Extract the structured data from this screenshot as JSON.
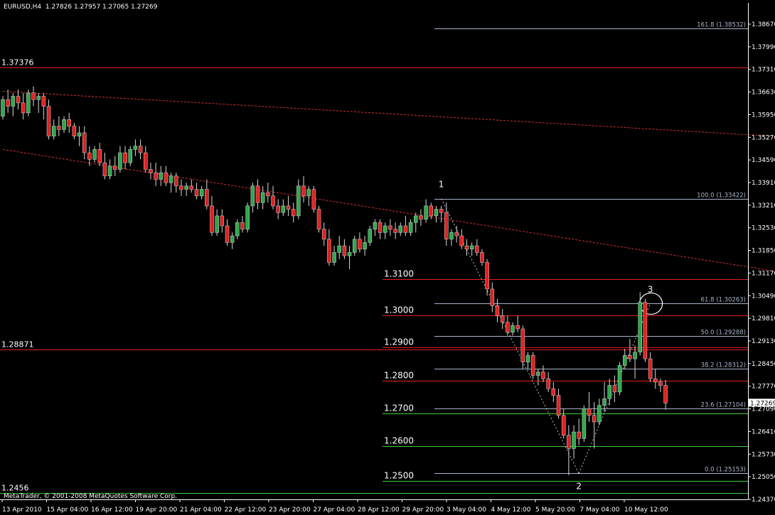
{
  "header": {
    "symbol": "EURUSD,H4",
    "open": "1.27826",
    "high": "1.27957",
    "low": "1.27065",
    "close": "1.27269"
  },
  "footer": {
    "copyright": "MetaTrader, © 2001-2008 MetaQuotes Software Corp."
  },
  "colors": {
    "background": "#000000",
    "axis": "#ffffff",
    "bull": "#2ea84a",
    "bear": "#e02020",
    "resistance": "#e02020",
    "support": "#3cc83c",
    "fib": "#a8b4c8",
    "trend": "#d03030",
    "wave": "#ffffff"
  },
  "chart_data": {
    "type": "candlestick",
    "symbol": "EURUSD",
    "timeframe": "H4",
    "ylim": [
      1.2437,
      1.3867
    ],
    "y_ticks": [
      "1.38670",
      "1.37990",
      "1.37310",
      "1.36630",
      "1.35950",
      "1.35270",
      "1.34590",
      "1.33910",
      "1.33210",
      "1.32530",
      "1.31850",
      "1.31170",
      "1.30490",
      "1.29810",
      "1.29130",
      "1.28450",
      "1.27770",
      "1.27090",
      "1.26410",
      "1.25730",
      "1.25050",
      "1.24370"
    ],
    "current_price": "1.27269",
    "x_ticks": [
      "13 Apr 2010",
      "15 Apr 04:00",
      "16 Apr 12:00",
      "19 Apr 20:00",
      "21 Apr 04:00",
      "22 Apr 12:00",
      "23 Apr 20:00",
      "27 Apr 04:00",
      "28 Apr 12:00",
      "29 Apr 20:00",
      "3 May 04:00",
      "4 May 12:00",
      "5 May 20:00",
      "7 May 04:00",
      "10 May 12:00"
    ],
    "candles": [
      [
        1.359,
        1.365,
        1.358,
        1.364
      ],
      [
        1.364,
        1.367,
        1.36,
        1.362
      ],
      [
        1.362,
        1.366,
        1.359,
        1.365
      ],
      [
        1.365,
        1.367,
        1.361,
        1.363
      ],
      [
        1.363,
        1.366,
        1.358,
        1.36
      ],
      [
        1.36,
        1.367,
        1.359,
        1.366
      ],
      [
        1.366,
        1.368,
        1.362,
        1.364
      ],
      [
        1.364,
        1.366,
        1.36,
        1.365
      ],
      [
        1.365,
        1.366,
        1.358,
        1.362
      ],
      [
        1.362,
        1.364,
        1.352,
        1.353
      ],
      [
        1.353,
        1.358,
        1.352,
        1.356
      ],
      [
        1.356,
        1.359,
        1.353,
        1.355
      ],
      [
        1.355,
        1.359,
        1.354,
        1.358
      ],
      [
        1.358,
        1.36,
        1.354,
        1.356
      ],
      [
        1.356,
        1.357,
        1.352,
        1.353
      ],
      [
        1.353,
        1.356,
        1.35,
        1.354
      ],
      [
        1.354,
        1.356,
        1.346,
        1.348
      ],
      [
        1.348,
        1.35,
        1.344,
        1.346
      ],
      [
        1.346,
        1.35,
        1.345,
        1.349
      ],
      [
        1.349,
        1.351,
        1.344,
        1.345
      ],
      [
        1.345,
        1.348,
        1.34,
        1.341
      ],
      [
        1.341,
        1.346,
        1.34,
        1.344
      ],
      [
        1.344,
        1.347,
        1.341,
        1.343
      ],
      [
        1.343,
        1.35,
        1.342,
        1.348
      ],
      [
        1.348,
        1.35,
        1.343,
        1.345
      ],
      [
        1.345,
        1.35,
        1.344,
        1.349
      ],
      [
        1.349,
        1.352,
        1.347,
        1.35
      ],
      [
        1.35,
        1.352,
        1.346,
        1.348
      ],
      [
        1.348,
        1.35,
        1.342,
        1.343
      ],
      [
        1.343,
        1.345,
        1.34,
        1.342
      ],
      [
        1.342,
        1.345,
        1.338,
        1.34
      ],
      [
        1.34,
        1.344,
        1.338,
        1.342
      ],
      [
        1.342,
        1.344,
        1.338,
        1.339
      ],
      [
        1.339,
        1.342,
        1.336,
        1.341
      ],
      [
        1.341,
        1.342,
        1.336,
        1.338
      ],
      [
        1.338,
        1.34,
        1.335,
        1.337
      ],
      [
        1.337,
        1.339,
        1.335,
        1.338
      ],
      [
        1.338,
        1.34,
        1.336,
        1.337
      ],
      [
        1.337,
        1.339,
        1.334,
        1.335
      ],
      [
        1.335,
        1.338,
        1.334,
        1.337
      ],
      [
        1.337,
        1.34,
        1.331,
        1.332
      ],
      [
        1.332,
        1.335,
        1.323,
        1.324
      ],
      [
        1.324,
        1.331,
        1.323,
        1.329
      ],
      [
        1.329,
        1.331,
        1.324,
        1.326
      ],
      [
        1.326,
        1.328,
        1.32,
        1.321
      ],
      [
        1.321,
        1.324,
        1.319,
        1.323
      ],
      [
        1.323,
        1.328,
        1.322,
        1.327
      ],
      [
        1.327,
        1.329,
        1.324,
        1.325
      ],
      [
        1.325,
        1.333,
        1.324,
        1.332
      ],
      [
        1.332,
        1.339,
        1.33,
        1.338
      ],
      [
        1.338,
        1.34,
        1.331,
        1.333
      ],
      [
        1.333,
        1.338,
        1.331,
        1.336
      ],
      [
        1.336,
        1.339,
        1.333,
        1.335
      ],
      [
        1.335,
        1.338,
        1.331,
        1.332
      ],
      [
        1.332,
        1.334,
        1.328,
        1.33
      ],
      [
        1.33,
        1.334,
        1.329,
        1.332
      ],
      [
        1.332,
        1.335,
        1.329,
        1.331
      ],
      [
        1.331,
        1.333,
        1.327,
        1.329
      ],
      [
        1.329,
        1.34,
        1.328,
        1.338
      ],
      [
        1.338,
        1.341,
        1.333,
        1.335
      ],
      [
        1.335,
        1.338,
        1.332,
        1.337
      ],
      [
        1.337,
        1.338,
        1.33,
        1.331
      ],
      [
        1.331,
        1.332,
        1.324,
        1.325
      ],
      [
        1.325,
        1.327,
        1.32,
        1.322
      ],
      [
        1.322,
        1.325,
        1.314,
        1.315
      ],
      [
        1.315,
        1.32,
        1.314,
        1.318
      ],
      [
        1.318,
        1.323,
        1.316,
        1.32
      ],
      [
        1.32,
        1.322,
        1.316,
        1.317
      ],
      [
        1.317,
        1.32,
        1.313,
        1.318
      ],
      [
        1.318,
        1.323,
        1.317,
        1.322
      ],
      [
        1.322,
        1.324,
        1.318,
        1.319
      ],
      [
        1.319,
        1.323,
        1.317,
        1.321
      ],
      [
        1.321,
        1.326,
        1.32,
        1.325
      ],
      [
        1.325,
        1.328,
        1.323,
        1.327
      ],
      [
        1.327,
        1.328,
        1.322,
        1.324
      ],
      [
        1.324,
        1.327,
        1.322,
        1.326
      ],
      [
        1.326,
        1.328,
        1.323,
        1.325
      ],
      [
        1.325,
        1.327,
        1.322,
        1.324
      ],
      [
        1.324,
        1.327,
        1.323,
        1.326
      ],
      [
        1.326,
        1.329,
        1.323,
        1.324
      ],
      [
        1.324,
        1.328,
        1.323,
        1.327
      ],
      [
        1.327,
        1.33,
        1.324,
        1.329
      ],
      [
        1.329,
        1.331,
        1.326,
        1.328
      ],
      [
        1.328,
        1.334,
        1.327,
        1.332
      ],
      [
        1.332,
        1.333,
        1.328,
        1.329
      ],
      [
        1.329,
        1.332,
        1.327,
        1.331
      ],
      [
        1.331,
        1.332,
        1.327,
        1.33
      ],
      [
        1.33,
        1.333,
        1.32,
        1.322
      ],
      [
        1.322,
        1.325,
        1.32,
        1.324
      ],
      [
        1.324,
        1.326,
        1.321,
        1.323
      ],
      [
        1.323,
        1.325,
        1.319,
        1.32
      ],
      [
        1.32,
        1.322,
        1.317,
        1.319
      ],
      [
        1.319,
        1.321,
        1.317,
        1.32
      ],
      [
        1.32,
        1.322,
        1.317,
        1.318
      ],
      [
        1.318,
        1.319,
        1.314,
        1.315
      ],
      [
        1.315,
        1.316,
        1.305,
        1.307
      ],
      [
        1.307,
        1.309,
        1.3,
        1.302
      ],
      [
        1.302,
        1.304,
        1.297,
        1.299
      ],
      [
        1.299,
        1.301,
        1.295,
        1.297
      ],
      [
        1.297,
        1.299,
        1.293,
        1.294
      ],
      [
        1.294,
        1.297,
        1.293,
        1.296
      ],
      [
        1.296,
        1.299,
        1.294,
        1.295
      ],
      [
        1.295,
        1.296,
        1.283,
        1.285
      ],
      [
        1.285,
        1.288,
        1.283,
        1.287
      ],
      [
        1.287,
        1.288,
        1.28,
        1.281
      ],
      [
        1.281,
        1.283,
        1.278,
        1.282
      ],
      [
        1.282,
        1.284,
        1.279,
        1.28
      ],
      [
        1.28,
        1.282,
        1.276,
        1.277
      ],
      [
        1.277,
        1.279,
        1.273,
        1.275
      ],
      [
        1.275,
        1.277,
        1.268,
        1.269
      ],
      [
        1.269,
        1.271,
        1.262,
        1.263
      ],
      [
        1.263,
        1.266,
        1.251,
        1.259
      ],
      [
        1.259,
        1.266,
        1.256,
        1.264
      ],
      [
        1.264,
        1.268,
        1.26,
        1.262
      ],
      [
        1.262,
        1.272,
        1.261,
        1.271
      ],
      [
        1.271,
        1.276,
        1.267,
        1.269
      ],
      [
        1.269,
        1.273,
        1.259,
        1.267
      ],
      [
        1.267,
        1.274,
        1.266,
        1.272
      ],
      [
        1.272,
        1.279,
        1.27,
        1.274
      ],
      [
        1.274,
        1.28,
        1.272,
        1.278
      ],
      [
        1.278,
        1.281,
        1.273,
        1.276
      ],
      [
        1.276,
        1.285,
        1.275,
        1.284
      ],
      [
        1.284,
        1.289,
        1.283,
        1.287
      ],
      [
        1.287,
        1.292,
        1.285,
        1.286
      ],
      [
        1.286,
        1.29,
        1.28,
        1.288
      ],
      [
        1.288,
        1.306,
        1.287,
        1.303
      ],
      [
        1.303,
        1.304,
        1.285,
        1.286
      ],
      [
        1.286,
        1.288,
        1.279,
        1.28
      ],
      [
        1.28,
        1.283,
        1.277,
        1.279
      ],
      [
        1.279,
        1.28,
        1.276,
        1.278
      ],
      [
        1.278,
        1.2796,
        1.2707,
        1.2727
      ]
    ],
    "horizontal_levels": [
      {
        "label": "1.37376",
        "value": 1.37376,
        "color": "resistance",
        "extent": "full"
      },
      {
        "label": "1.28871",
        "value": 1.28871,
        "color": "resistance",
        "extent": "full"
      },
      {
        "label": "1.2456",
        "value": 1.2456,
        "color": "support",
        "extent": "full"
      },
      {
        "label": "1.3100",
        "value": 1.31,
        "color": "resistance",
        "extent": "right"
      },
      {
        "label": "1.3000",
        "value": 1.299,
        "color": "resistance",
        "extent": "right"
      },
      {
        "label": "1.2900",
        "value": 1.2895,
        "color": "resistance",
        "extent": "right"
      },
      {
        "label": "1.2800",
        "value": 1.2795,
        "color": "resistance",
        "extent": "right"
      },
      {
        "label": "1.2700",
        "value": 1.2695,
        "color": "support",
        "extent": "right"
      },
      {
        "label": "1.2600",
        "value": 1.2597,
        "color": "support",
        "extent": "right"
      },
      {
        "label": "1.2500",
        "value": 1.2492,
        "color": "support",
        "extent": "right"
      }
    ],
    "fib_levels": [
      {
        "label": "161.8 (1.38532)",
        "value": 1.38532
      },
      {
        "label": "100.0 (1.33422)",
        "value": 1.33422
      },
      {
        "label": "61.8 (1.30263)",
        "value": 1.30263
      },
      {
        "label": "50.0 (1.29288)",
        "value": 1.29288
      },
      {
        "label": "38.2 (1.28312)",
        "value": 1.28312
      },
      {
        "label": "23.6 (1.27104)",
        "value": 1.27104
      },
      {
        "label": "0.0 (1.25153)",
        "value": 1.25153
      }
    ],
    "trend_lines": [
      {
        "from": [
          0,
          1.3665
        ],
        "to": [
          151,
          1.353
        ]
      },
      {
        "from": [
          0,
          1.349
        ],
        "to": [
          151,
          1.3125
        ]
      }
    ],
    "wave_points": [
      {
        "label": "1",
        "index": 86,
        "value": 1.3342
      },
      {
        "label": "2",
        "index": 113,
        "value": 1.2515
      },
      {
        "label": "3",
        "index": 127,
        "value": 1.3026
      }
    ]
  }
}
